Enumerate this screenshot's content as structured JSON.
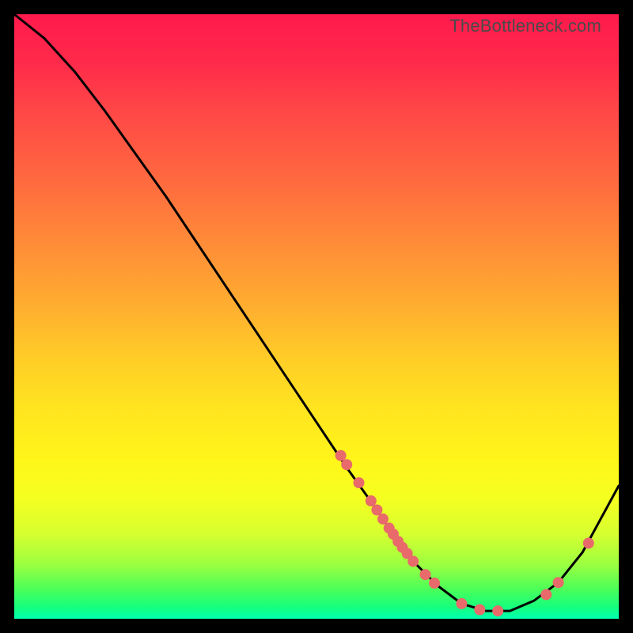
{
  "watermark": "TheBottleneck.com",
  "colors": {
    "page_bg": "#000000",
    "gradient_top": "#ff1a4d",
    "gradient_bottom": "#00ffb0",
    "curve": "#000000",
    "dot": "#e86a6a"
  },
  "chart_data": {
    "type": "line",
    "title": "",
    "xlabel": "",
    "ylabel": "",
    "xlim": [
      0,
      100
    ],
    "ylim": [
      0,
      100
    ],
    "grid": false,
    "legend": false,
    "series": [
      {
        "name": "curve",
        "x": [
          0,
          5,
          10,
          15,
          20,
          25,
          30,
          35,
          40,
          45,
          50,
          55,
          60,
          63,
          66,
          70,
          74,
          78,
          82,
          86,
          90,
          94,
          100
        ],
        "y": [
          100,
          96,
          90.5,
          84,
          77,
          70,
          62.5,
          55,
          47.5,
          40,
          32.5,
          25,
          18,
          13.5,
          9.5,
          5.5,
          2.5,
          1.3,
          1.3,
          3,
          6,
          11,
          22
        ]
      }
    ],
    "points": [
      {
        "name": "p1",
        "x": 54,
        "y": 27
      },
      {
        "name": "p2",
        "x": 55,
        "y": 25.5
      },
      {
        "name": "p3",
        "x": 57,
        "y": 22.5
      },
      {
        "name": "p4",
        "x": 59,
        "y": 19.5
      },
      {
        "name": "p5",
        "x": 60,
        "y": 18
      },
      {
        "name": "p6",
        "x": 61,
        "y": 16.5
      },
      {
        "name": "p7",
        "x": 62,
        "y": 15
      },
      {
        "name": "p8",
        "x": 62.7,
        "y": 14
      },
      {
        "name": "p9",
        "x": 63.5,
        "y": 12.8
      },
      {
        "name": "p10",
        "x": 64.2,
        "y": 11.8
      },
      {
        "name": "p11",
        "x": 65,
        "y": 10.8
      },
      {
        "name": "p12",
        "x": 66,
        "y": 9.5
      },
      {
        "name": "p13",
        "x": 68,
        "y": 7.3
      },
      {
        "name": "p14",
        "x": 69.5,
        "y": 5.9
      },
      {
        "name": "p15",
        "x": 74,
        "y": 2.5
      },
      {
        "name": "p16",
        "x": 77,
        "y": 1.5
      },
      {
        "name": "p17",
        "x": 80,
        "y": 1.3
      },
      {
        "name": "p18",
        "x": 88,
        "y": 4
      },
      {
        "name": "p19",
        "x": 90,
        "y": 6
      },
      {
        "name": "p20",
        "x": 95,
        "y": 12.5
      }
    ]
  }
}
